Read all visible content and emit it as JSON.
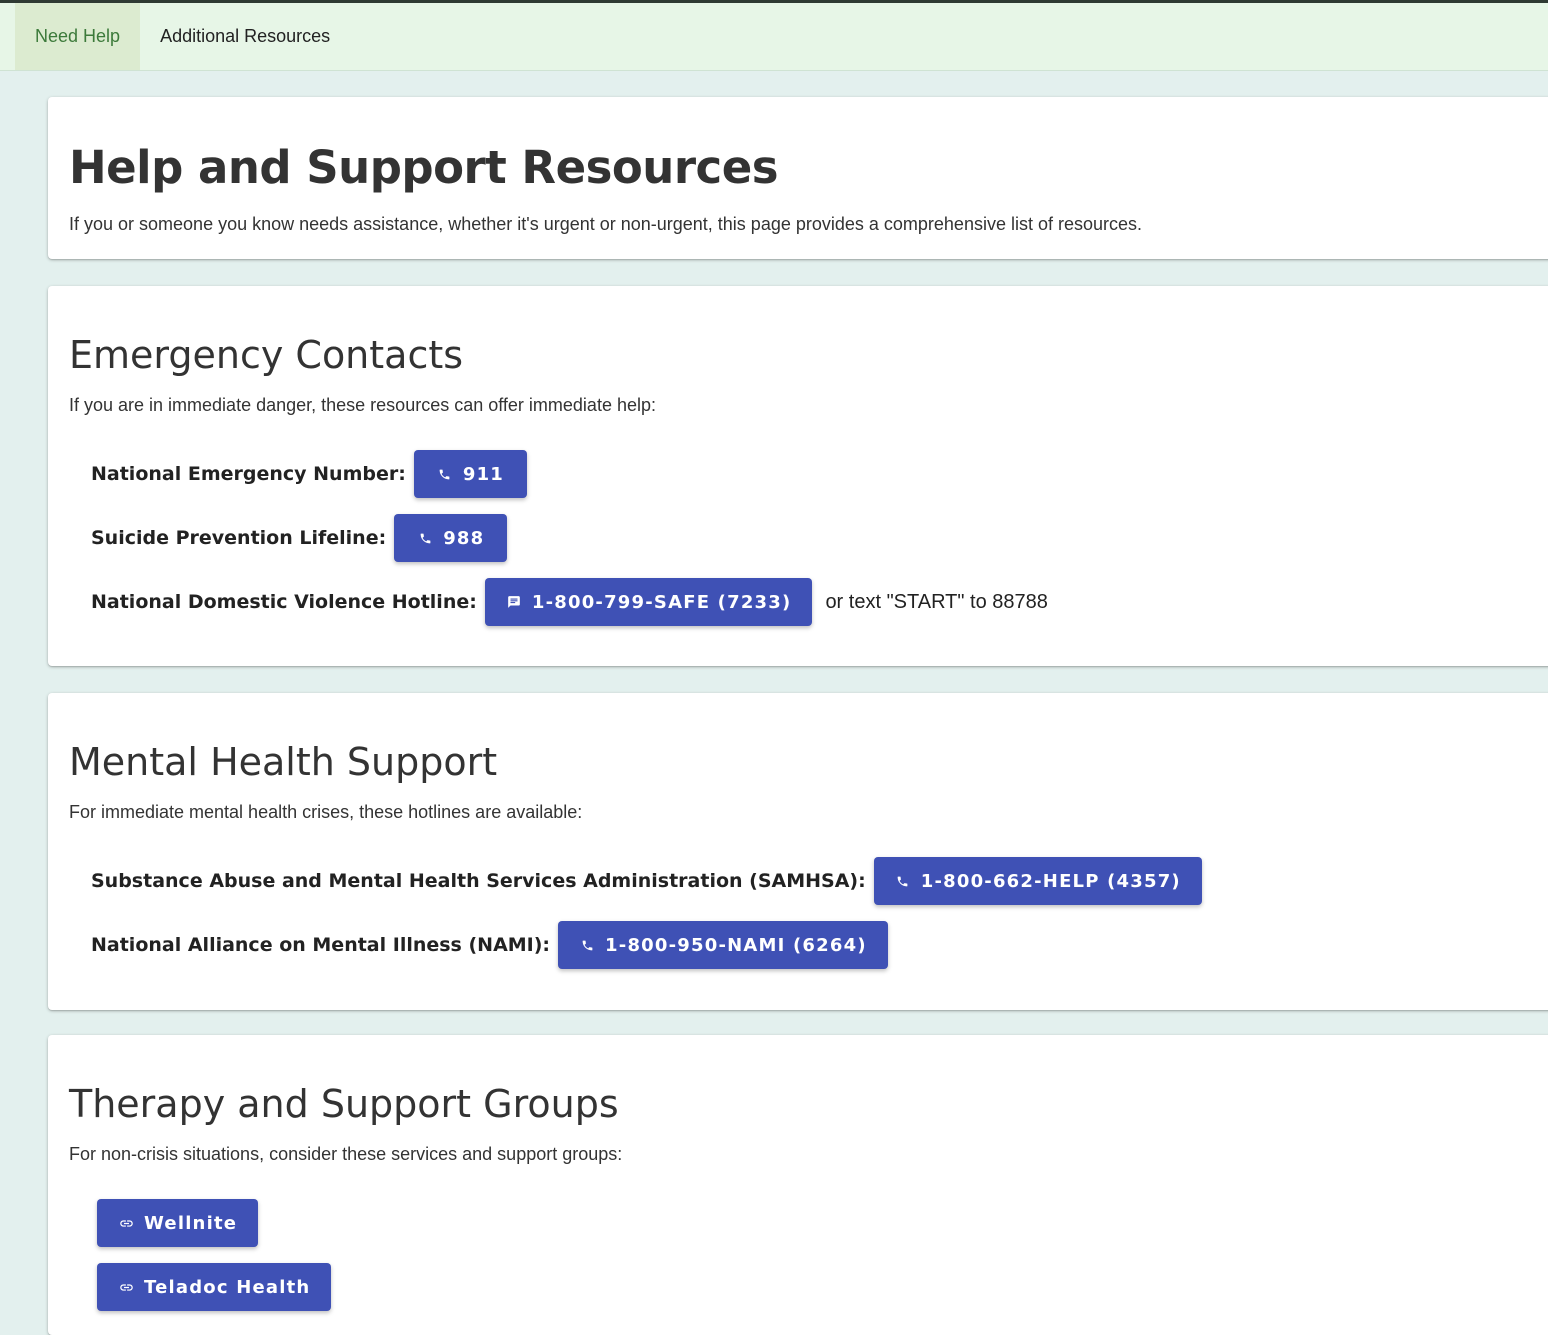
{
  "nav": {
    "tabs": [
      {
        "label": "Need Help",
        "active": true
      },
      {
        "label": "Additional Resources",
        "active": false
      }
    ]
  },
  "intro": {
    "title": "Help and Support Resources",
    "description": "If you or someone you know needs assistance, whether it's urgent or non-urgent, this page provides a comprehensive list of resources."
  },
  "emergency": {
    "title": "Emergency Contacts",
    "description": "If you are in immediate danger, these resources can offer immediate help:",
    "items": [
      {
        "label": "National Emergency Number:",
        "button": "911",
        "icon": "phone-icon"
      },
      {
        "label": "Suicide Prevention Lifeline:",
        "button": "988",
        "icon": "phone-icon"
      },
      {
        "label": "National Domestic Violence Hotline:",
        "button": "1-800-799-SAFE (7233)",
        "icon": "message-icon",
        "after": "or text \"START\" to 88788"
      }
    ]
  },
  "mental": {
    "title": "Mental Health Support",
    "description": "For immediate mental health crises, these hotlines are available:",
    "items": [
      {
        "label": "Substance Abuse and Mental Health Services Administration (SAMHSA):",
        "button": "1-800-662-HELP (4357)",
        "icon": "phone-icon"
      },
      {
        "label": "National Alliance on Mental Illness (NAMI):",
        "button": "1-800-950-NAMI (6264)",
        "icon": "phone-icon"
      }
    ]
  },
  "therapy": {
    "title": "Therapy and Support Groups",
    "description": "For non-crisis situations, consider these services and support groups:",
    "links": [
      {
        "label": "Wellnite",
        "icon": "link-icon"
      },
      {
        "label": "Teladoc Health",
        "icon": "link-icon"
      }
    ]
  },
  "colors": {
    "button": "#3f51b5",
    "topbar": "#e7f6e7",
    "active_tab": "#dcebd0",
    "active_tab_text": "#3c7a3a",
    "page_bg": "#e3f0ee"
  }
}
